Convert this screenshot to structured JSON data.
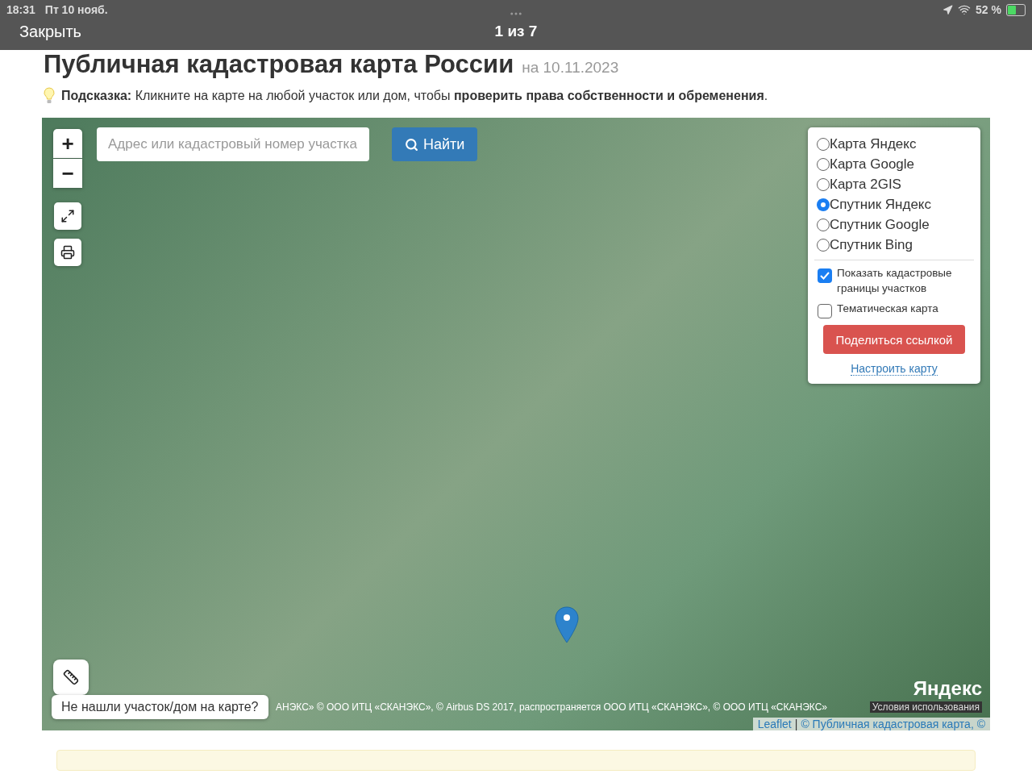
{
  "status_bar": {
    "time": "18:31",
    "date": "Пт 10 нояб.",
    "battery": "52 %"
  },
  "viewer": {
    "close": "Закрыть",
    "counter": "1 из 7"
  },
  "page": {
    "title": "Публичная кадастровая карта России",
    "date": "на 10.11.2023",
    "hint": "**Подсказка:** Кликните на карте на любой участок или дом, чтобы **проверить права собственности и обременения**."
  },
  "map": {
    "search": {
      "placeholder": "Адрес или кадастровый номер участка",
      "button": "Найти"
    },
    "zoom_in": "+",
    "zoom_out": "−",
    "layers": [
      {
        "label": "Карта Яндекс",
        "selected": false
      },
      {
        "label": "Карта Google",
        "selected": false
      },
      {
        "label": "Карта 2GIS",
        "selected": false
      },
      {
        "label": "Спутник Яндекс",
        "selected": true
      },
      {
        "label": "Спутник Google",
        "selected": false
      },
      {
        "label": "Спутник Bing",
        "selected": false
      }
    ],
    "options": [
      {
        "label": "Показать кадастровые границы участков",
        "checked": true
      },
      {
        "label": "Тематическая карта",
        "checked": false
      }
    ],
    "share": "Поделиться ссылкой",
    "settings": "Настроить карту",
    "not_found": "Не нашли участок/дом на карте?",
    "attribution": "АНЭКС» © ООО ИТЦ «СКАНЭКС», © Airbus DS 2017, распространяется ООО ИТЦ «СКАНЭКС», © ООО ИТЦ «СКАНЭКС»",
    "terms": "Условия использования",
    "logo": "Яндекс",
    "leaflet": "Leaflet",
    "separator": "|",
    "copyright": "© Публичная кадастровая карта, ©"
  }
}
